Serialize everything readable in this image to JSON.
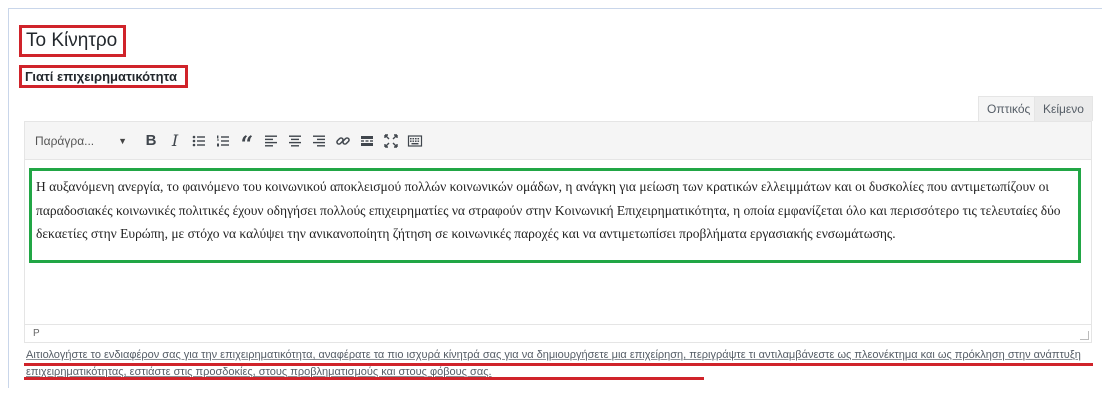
{
  "section": {
    "title": "Το Κίνητρο"
  },
  "field": {
    "label": "Γιατί επιχειρηματικότητα"
  },
  "editor": {
    "tabs": [
      "Οπτικός",
      "Κείμενο"
    ],
    "toolbar": {
      "format_select": "Παράγρα...",
      "bold": "B",
      "italic": "I",
      "quote": "“"
    },
    "content": "Η αυξανόμενη ανεργία, το φαινόμενο του κοινωνικού αποκλεισμού πολλών κοινωνικών ομάδων, η ανάγκη για μείωση των κρατικών ελλειμμάτων και οι δυσκολίες που αντιμετωπίζουν οι παραδοσιακές κοινωνικές πολιτικές έχουν οδηγήσει πολλούς επιχειρηματίες να στραφούν στην Κοινωνική Επιχειρηματικότητα, η οποία εμφανίζεται όλο και περισσότερο τις τελευταίες δύο δεκαετίες στην Ευρώπη, με στόχο να καλύψει την ανικανοποίητη ζήτηση σε κοινωνικές παροχές και να αντιμετωπίσει προβλήματα εργασιακής ενσωμάτωσης.",
    "path": "P"
  },
  "help_text": "Αιτιολογήστε το ενδιαφέρον σας για την επιχειρηματικότητα, αναφέρατε τα πιο ισχυρά κίνητρά σας για να δημιουργήσετε μια επιχείρηση, περιγράψτε τι αντιλαμβάνεστε ως πλεονέκτημα και ως πρόκληση στην ανάπτυξη επιχειρηματικότητας, εστιάστε στις προσδοκίες, στους προβληματισμούς και στους φόβους σας.",
  "colors": {
    "highlight_red": "#d0232a",
    "highlight_green": "#21a645"
  }
}
